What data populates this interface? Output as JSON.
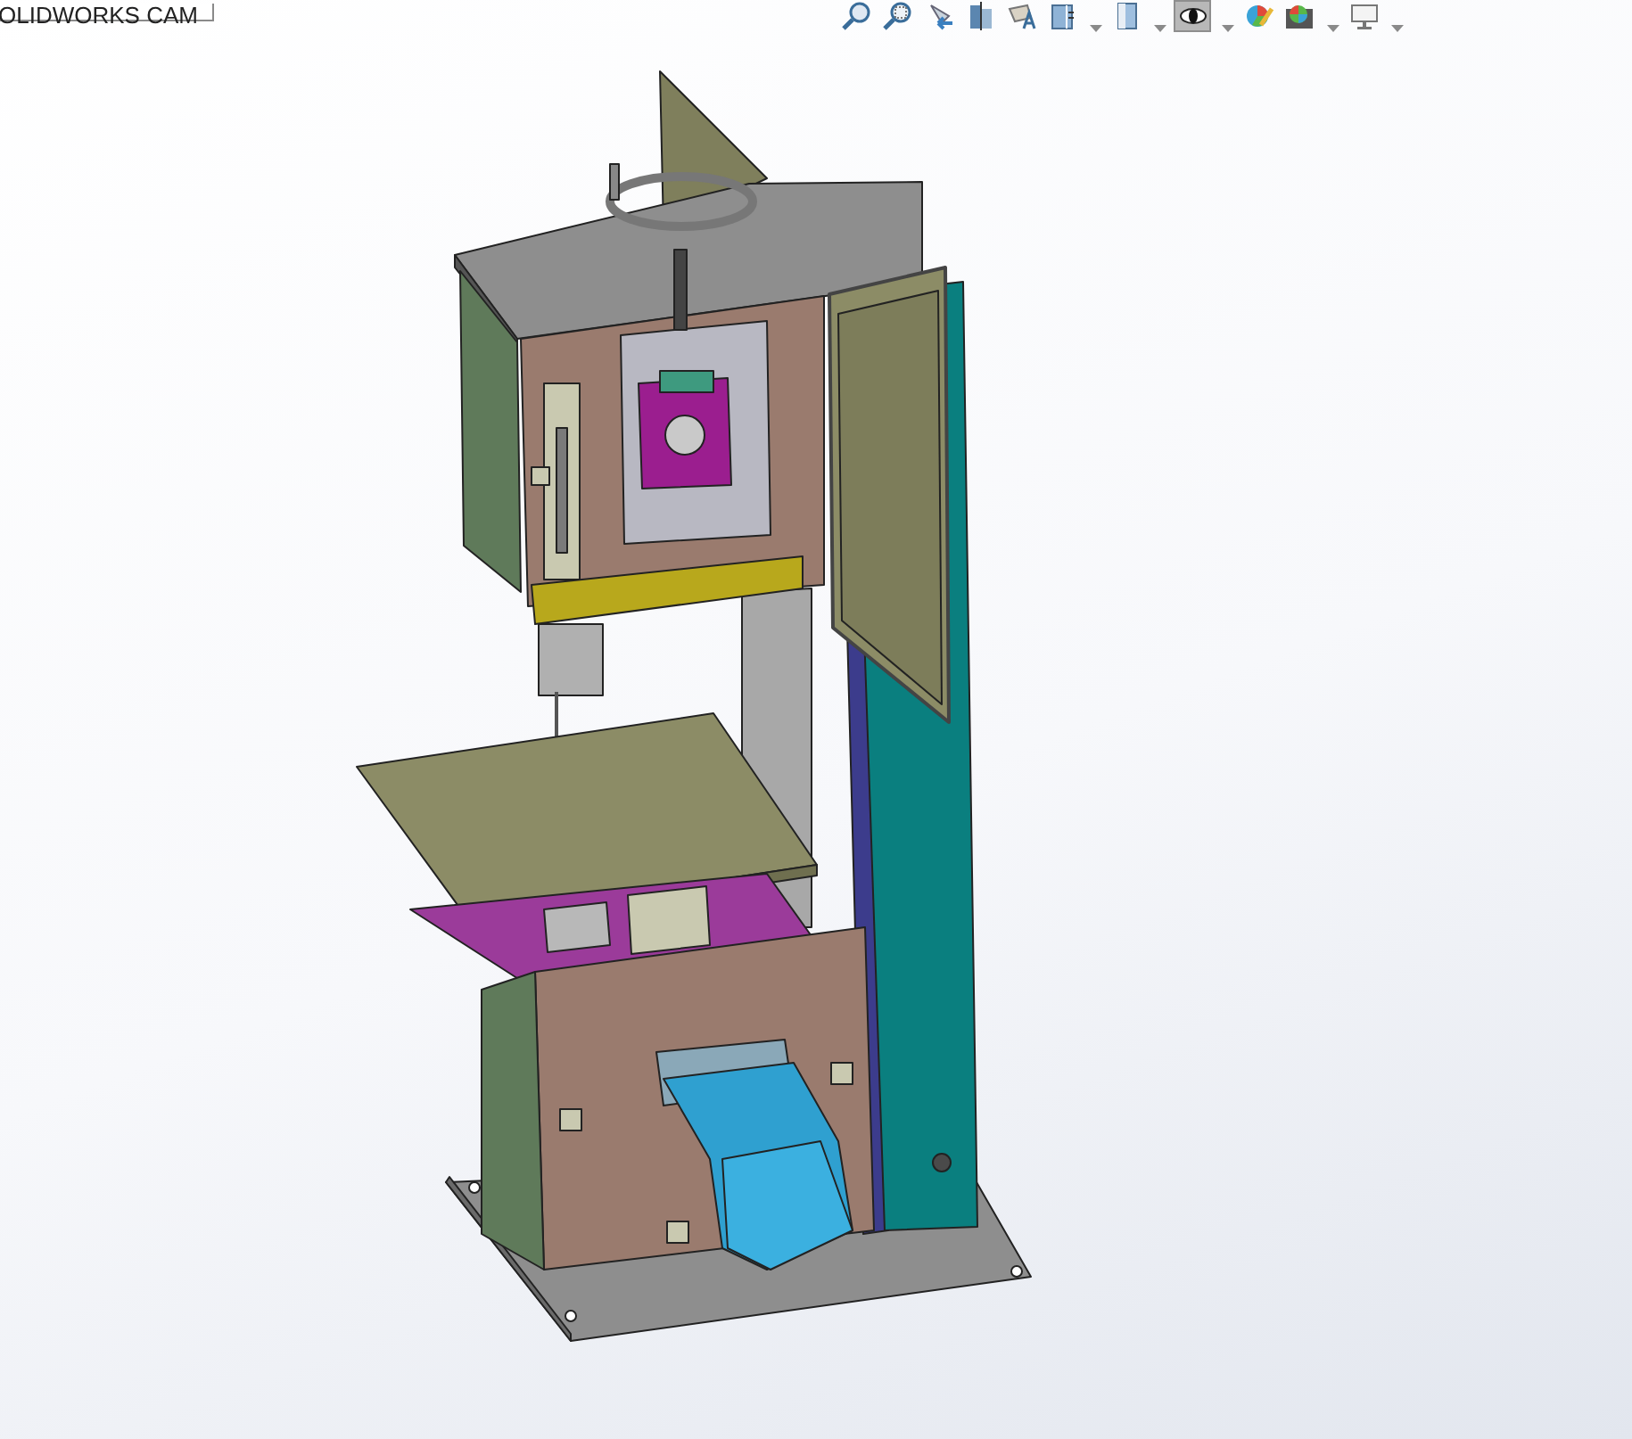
{
  "tab": {
    "label": "OLIDWORKS CAM"
  },
  "toolbar": [
    {
      "kind": "zoom-fit",
      "selected": false,
      "dropdown": false
    },
    {
      "kind": "zoom-area",
      "selected": false,
      "dropdown": false
    },
    {
      "kind": "previous-view",
      "selected": false,
      "dropdown": false
    },
    {
      "kind": "section-view",
      "selected": false,
      "dropdown": false
    },
    {
      "kind": "dynamic-annotation",
      "selected": false,
      "dropdown": false
    },
    {
      "kind": "view-orientation",
      "selected": false,
      "dropdown": true
    },
    {
      "kind": "display-style",
      "selected": false,
      "dropdown": true
    },
    {
      "kind": "hide-show",
      "selected": true,
      "dropdown": true
    },
    {
      "kind": "appearance",
      "selected": false,
      "dropdown": false
    },
    {
      "kind": "scene",
      "selected": false,
      "dropdown": true
    },
    {
      "kind": "view-settings",
      "selected": false,
      "dropdown": true
    }
  ]
}
